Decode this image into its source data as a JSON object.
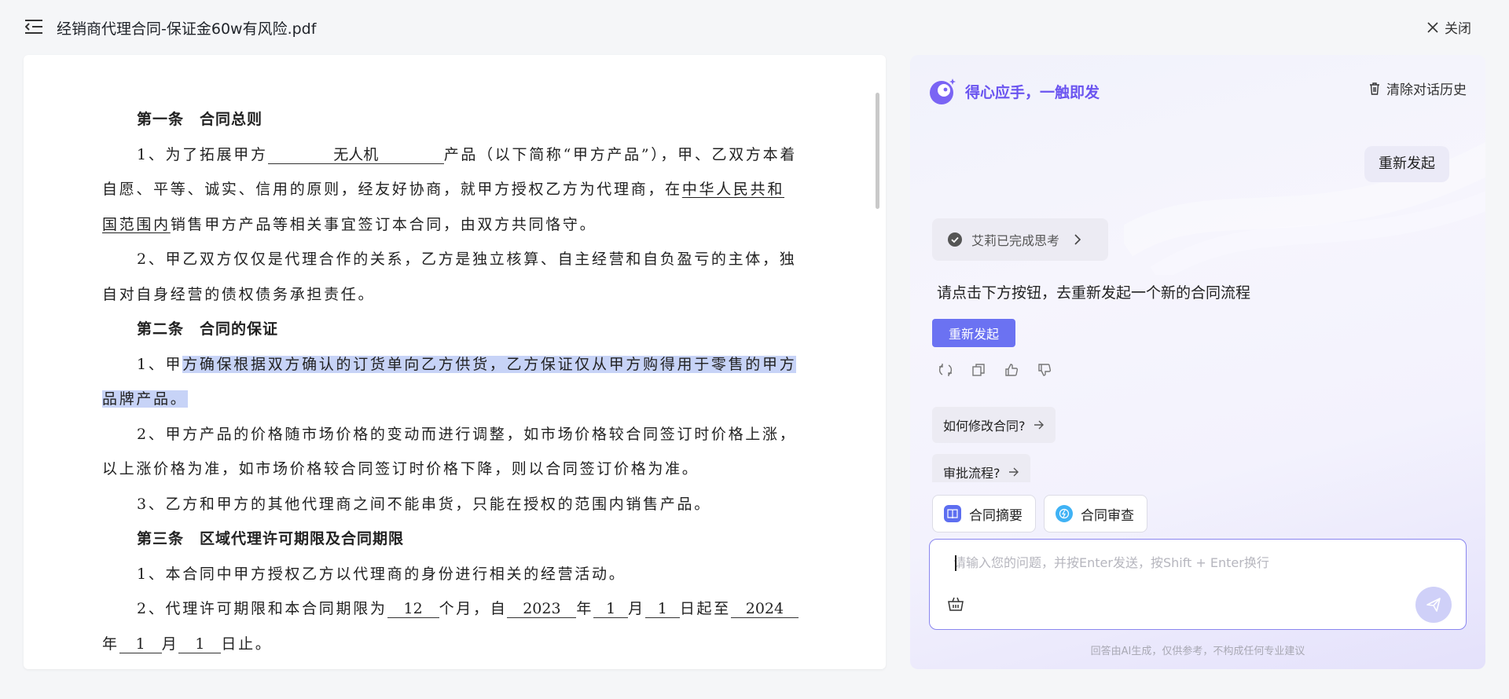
{
  "topbar": {
    "file_title": "经销商代理合同-保证金60w有风险.pdf",
    "close_label": "关闭"
  },
  "document": {
    "line1_heading": "第一条　合同总则",
    "line2_a": "1、为了拓展甲方",
    "line2_blank": "无人机",
    "line2_b": "产品（以下简称“甲方产品”），甲、乙双方本着",
    "line3_a": "自愿、平等、诚实、信用的原则，经友好协商，就甲方授权乙方为代理商，在",
    "line3_ul": "中华人民共和",
    "line4_ul": "国范围内",
    "line4_b": "销售甲方产品等相关事宜签订本合同，由双方共同恪守。",
    "line5": "2、甲乙双方仅仅是代理合作的关系，乙方是独立核算、自主经营和自负盈亏的主体，独",
    "line6": "自对自身经营的债权债务承担责任。",
    "line7_heading": "第二条　合同的保证",
    "line8_a": "1、甲",
    "line8_hl": "方确保根据双方确认的订货单向乙方供货，乙方保证仅从甲方购得用于零售的甲方",
    "line9_hl": "品牌产品。",
    "line10": "2、甲方产品的价格随市场价格的变动而进行调整，如市场价格较合同签订时价格上涨，",
    "line11": "以上涨价格为准，如市场价格较合同签订时价格下降，则以合同签订价格为准。",
    "line12": "3、乙方和甲方的其他代理商之间不能串货，只能在授权的范围内销售产品。",
    "line13_heading": "第三条　区域代理许可期限及合同期限",
    "line14": "1、本合同中甲方授权乙方以代理商的身份进行相关的经营活动。",
    "line15_a": "2、代理许可期限和本合同期限为",
    "line15_months": "12",
    "line15_b": "个月，自",
    "line15_year": "2023",
    "line15_c": "年",
    "line15_month": "1",
    "line15_d": "月",
    "line15_day": "1",
    "line15_e": "日起至",
    "line15_endyear": "2024",
    "line16_a": "年",
    "line16_month": "1",
    "line16_b": "月",
    "line16_day": "1",
    "line16_c": "日止。"
  },
  "chat": {
    "brand_text": "得心应手，一触即发",
    "clear_history": "清除对话历史",
    "user_message": "重新发起",
    "thinking_status": "艾莉已完成思考",
    "answer": "请点击下方按钮，去重新发起一个新的合同流程",
    "restart_button": "重新发起",
    "suggestions": [
      "如何修改合同?",
      "审批流程?"
    ],
    "tools": [
      "合同摘要",
      "合同审查"
    ],
    "input_placeholder": "请输入您的问题，并按Enter发送，按Shift + Enter换行",
    "disclaimer": "回答由AI生成，仅供参考，不构成任何专业建议"
  },
  "colors": {
    "accent": "#6b72f2",
    "brand": "#6a54f0",
    "highlight": "#c7d3f7"
  }
}
